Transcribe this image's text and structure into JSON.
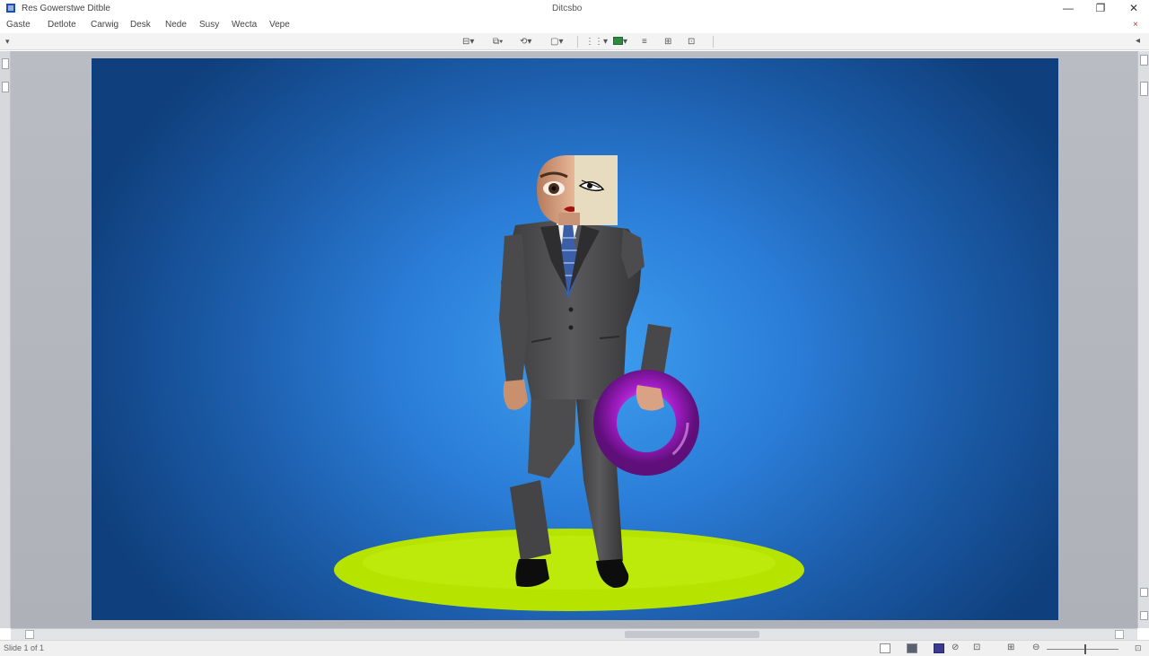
{
  "window": {
    "title": "Res Gowerstwe Ditble",
    "document_title": "Ditcsbo",
    "controls": {
      "minimize": "—",
      "maximize": "❐",
      "close": "✕"
    }
  },
  "menu": {
    "items": [
      "Gaste",
      "Detlote",
      "Carwig",
      "Desk",
      "Nede",
      "Susy",
      "Wecta",
      "Vepe"
    ],
    "close_mark": "×"
  },
  "toolbar": {
    "left_arrow": "▾",
    "right_arrow": "◂",
    "buttons": [
      "⊟▾",
      "⧉▾",
      "⟲▾",
      "▢▾",
      "⋮⋮▾",
      "▾",
      "≡",
      "⊞",
      "⊡"
    ]
  },
  "slide": {
    "background_center": "#3e9ff0",
    "background_edge": "#0f3f7c",
    "platform_color": "#b6e400",
    "ring_color": "#a21dc4",
    "suit_color": "#4a4a4c"
  },
  "statusbar": {
    "left_text": "Slide 1 of 1",
    "zoom_label": "⊡",
    "zoom_minus": "⊖",
    "icons": [
      "▯",
      "▦",
      "◼",
      "⊘",
      "⊡",
      "⊞",
      "⊖"
    ]
  }
}
